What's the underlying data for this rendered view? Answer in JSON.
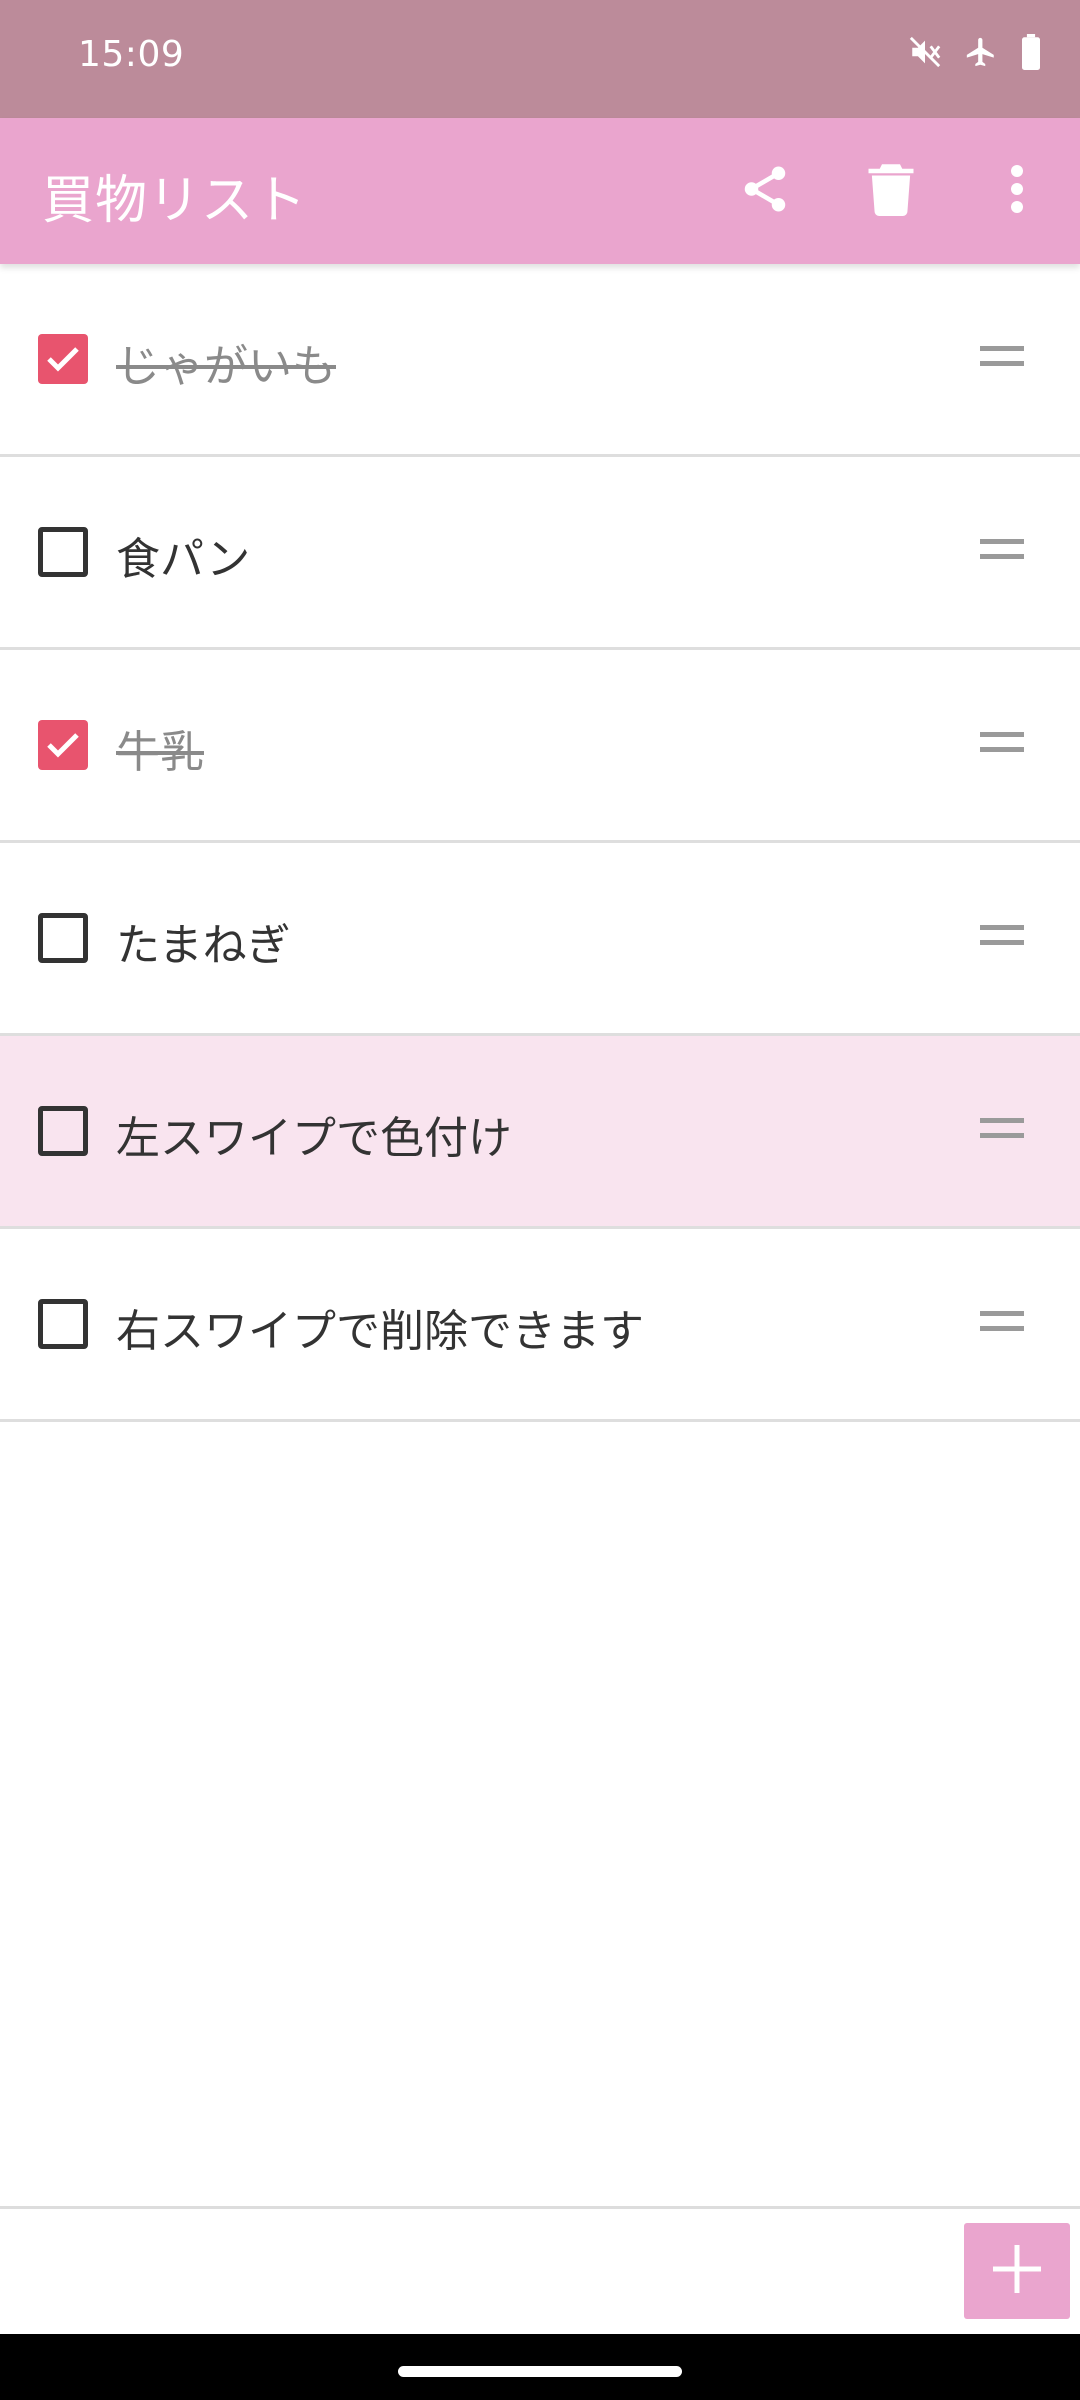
{
  "status_bar": {
    "time": "15:09",
    "icons": [
      "mute-icon",
      "airplane-icon",
      "battery-icon"
    ]
  },
  "app_bar": {
    "title": "買物リスト",
    "actions": [
      "share-icon",
      "delete-icon",
      "more-vert-icon"
    ]
  },
  "items": [
    {
      "label": "じゃがいも",
      "checked": true
    },
    {
      "label": "食パン",
      "checked": false
    },
    {
      "label": "牛乳",
      "checked": true
    },
    {
      "label": "たまねぎ",
      "checked": false
    },
    {
      "label": "左スワイプで色付け",
      "checked": false,
      "highlighted": true
    },
    {
      "label": "右スワイプで削除できます",
      "checked": false
    }
  ],
  "colors": {
    "status_bar": "#bc8b9a",
    "app_bar": "#eaa5ce",
    "checked": "#e8546e",
    "highlight_row": "#f9e4ef"
  }
}
